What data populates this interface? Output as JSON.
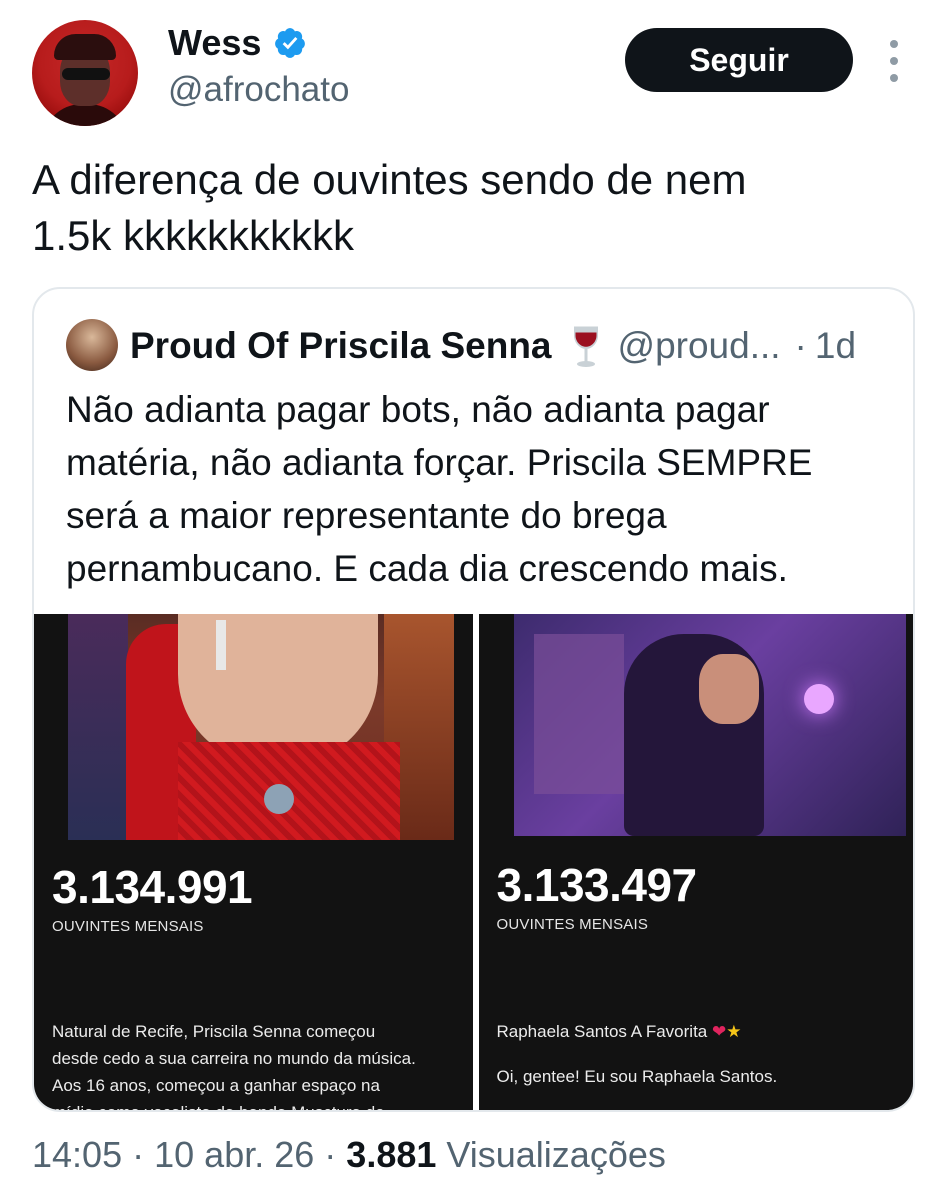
{
  "author": {
    "name": "Wess",
    "handle": "@afrochato",
    "follow_label": "Seguir"
  },
  "tweet": {
    "text_line1": "A diferença de ouvintes sendo de nem",
    "text_line2": "1.5k kkkkkkkkkkk"
  },
  "quote": {
    "name": "Proud Of Priscila Senna",
    "emoji": "wine-glass-icon",
    "handle": "@proud...",
    "separator": "·",
    "time": "1d",
    "lines": [
      "Não adianta pagar bots, não adianta pagar",
      "matéria, não adianta forçar. Priscila SEMPRE",
      "será a maior representante do brega",
      "pernambucano. E cada dia crescendo mais."
    ],
    "media": [
      {
        "listeners": "3.134.991",
        "label": "OUVINTES MENSAIS",
        "desc_lines": [
          "Natural de Recife, Priscila Senna começou",
          "desde cedo a sua carreira no mundo da música.",
          "Aos 16 anos, começou a ganhar espaço na",
          "mídia como vocalista da banda Musctura de"
        ]
      },
      {
        "listeners": "3.133.497",
        "label": "OUVINTES MENSAIS",
        "desc_title": "Raphaela Santos A Favorita",
        "desc_line2": "Oi, gentee! Eu sou Raphaela Santos."
      }
    ]
  },
  "meta": {
    "time": "14:05",
    "sep1": "·",
    "date": "10 abr. 26",
    "sep2": "·",
    "views": "3.881",
    "views_label": "Visualizações"
  },
  "colors": {
    "text": "#0f1419",
    "secondary": "#536471",
    "verified": "#1d9bf0",
    "follow_bg": "#0f1419",
    "media_bg": "#121212"
  }
}
